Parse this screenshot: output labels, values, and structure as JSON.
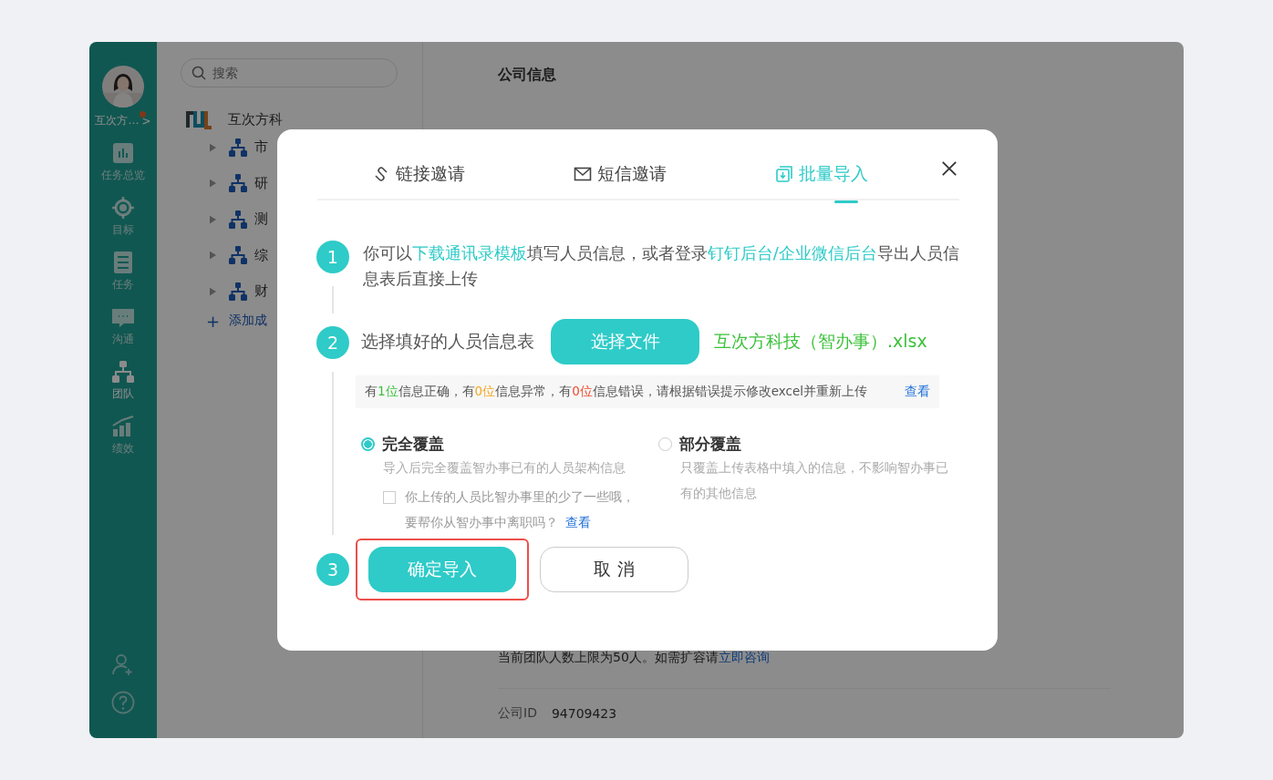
{
  "sidebar": {
    "user_name": "互次方…",
    "has_notice": true,
    "chevron": ">",
    "items": [
      {
        "label": "任务总览",
        "kind": "chart",
        "selected": false
      },
      {
        "label": "目标",
        "kind": "target",
        "selected": false
      },
      {
        "label": "任务",
        "kind": "list",
        "selected": false
      },
      {
        "label": "沟通",
        "kind": "chat",
        "selected": false
      },
      {
        "label": "团队",
        "kind": "org",
        "selected": true
      },
      {
        "label": "绩效",
        "kind": "growth",
        "selected": false
      }
    ]
  },
  "panel": {
    "search": {
      "placeholder": "搜索"
    },
    "org_name": "互次方科",
    "departments": [
      {
        "name": "市",
        "expanded": false
      },
      {
        "name": "研",
        "expanded": false
      },
      {
        "name": "测",
        "expanded": false
      },
      {
        "name": "综",
        "expanded": false
      },
      {
        "name": "财",
        "expanded": false
      }
    ],
    "add_member": {
      "icon": "+",
      "label": "添加成"
    }
  },
  "main": {
    "title": "公司信息",
    "notice": {
      "text": "当前团队人数上限为50人。如需扩容请",
      "link": "立即咨询"
    },
    "company_id": {
      "label": "公司ID",
      "value": "94709423"
    }
  },
  "dialog": {
    "tabs": [
      {
        "label": "链接邀请",
        "kind": "link",
        "selected": false
      },
      {
        "label": "短信邀请",
        "kind": "mail",
        "selected": false
      },
      {
        "label": "批量导入",
        "kind": "import",
        "selected": true
      }
    ],
    "step1": {
      "number": "1",
      "parts": [
        {
          "text": "你可以",
          "link": false
        },
        {
          "text": "下载通讯录模板",
          "link": true
        },
        {
          "text": "填写人员信息，或者登录",
          "link": false
        },
        {
          "text": "钉钉后台/企业微信后台",
          "link": true
        },
        {
          "text": "导出人员信息表后直接上传",
          "link": false
        }
      ]
    },
    "step2": {
      "number": "2",
      "label": "选择填好的人员信息表",
      "button": "选择文件",
      "file_name": "互次方科技（智办事）.xlsx",
      "result": {
        "parts": [
          {
            "text": "有",
            "color": "#555555"
          },
          {
            "text": "1位",
            "color": "#3cc13b"
          },
          {
            "text": "信息正确，有",
            "color": "#555555"
          },
          {
            "text": "0位",
            "color": "#f5a623"
          },
          {
            "text": "信息异常，有",
            "color": "#555555"
          },
          {
            "text": "0位",
            "color": "#f04a2e"
          },
          {
            "text": "信息错误，请根据错误提示修改excel并重新上传",
            "color": "#555555"
          }
        ],
        "link": "查看"
      }
    },
    "options": [
      {
        "title": "完全覆盖",
        "description": "导入后完全覆盖智办事已有的人员架构信息",
        "selected": true
      },
      {
        "title": "部分覆盖",
        "description": "只覆盖上传表格中填入的信息，不影响智办事已有的其他信息",
        "selected": false
      }
    ],
    "leave_check": {
      "checked": false,
      "text": "你上传的人员比智办事里的少了一些哦，要帮你从智办事中离职吗？",
      "link": "查看"
    },
    "step3": {
      "number": "3",
      "confirm": "确定导入",
      "cancel": "取 消",
      "highlighted": true
    }
  }
}
